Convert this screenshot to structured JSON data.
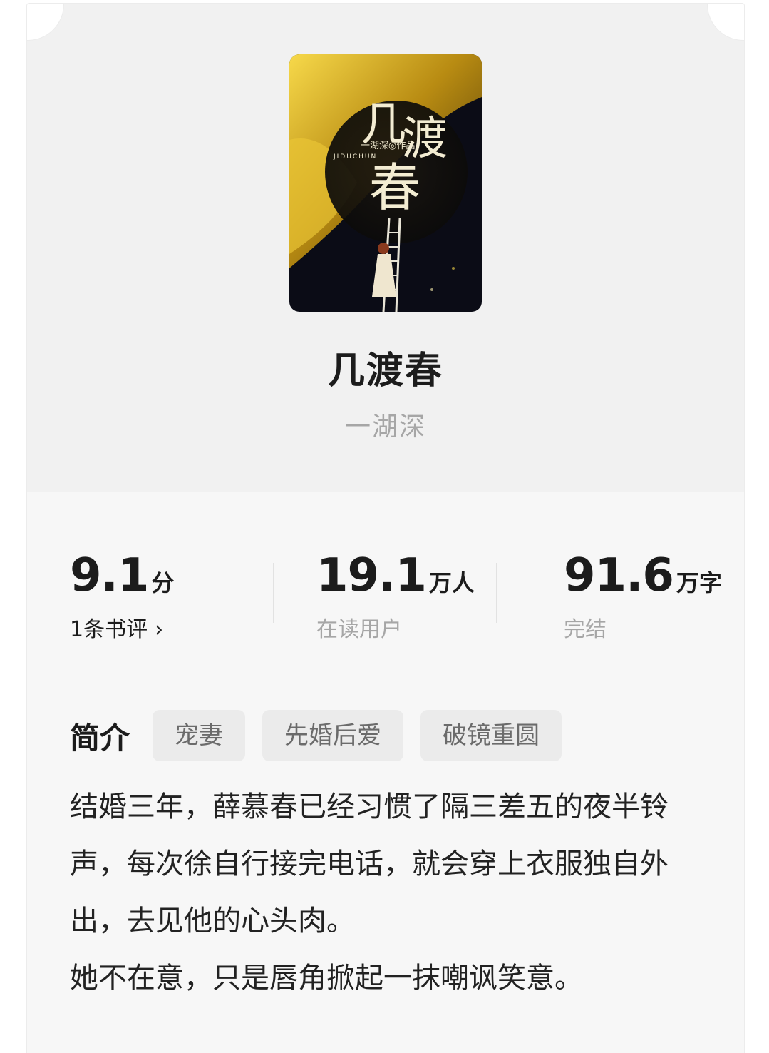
{
  "book": {
    "title": "几渡春",
    "author": "一湖深",
    "cover": {
      "title_chars": [
        "几",
        "渡",
        "春"
      ],
      "byline": "一湖深◎作品",
      "romanization": "JIDUCHUN"
    }
  },
  "stats": {
    "rating": {
      "value": "9.1",
      "unit": "分",
      "label": "1条书评",
      "chevron": "›"
    },
    "readers": {
      "value": "19.1",
      "unit": "万人",
      "label": "在读用户"
    },
    "words": {
      "value": "91.6",
      "unit": "万字",
      "label": "完结"
    }
  },
  "intro": {
    "heading": "简介",
    "tags": [
      "宠妻",
      "先婚后爱",
      "破镜重圆"
    ],
    "paragraphs": [
      "结婚三年，薛慕春已经习惯了隔三差五的夜半铃声，每次徐自行接完电话，就会穿上衣服独自外出，去见他的心头肉。",
      "她不在意，只是唇角掀起一抹嘲讽笑意。"
    ]
  },
  "colors": {
    "card_top": "#f1f1f1",
    "card_body": "#f7f7f7",
    "tag_bg": "#ebebeb",
    "muted_text": "#a6a6a6",
    "primary_text": "#1c1c1c"
  }
}
